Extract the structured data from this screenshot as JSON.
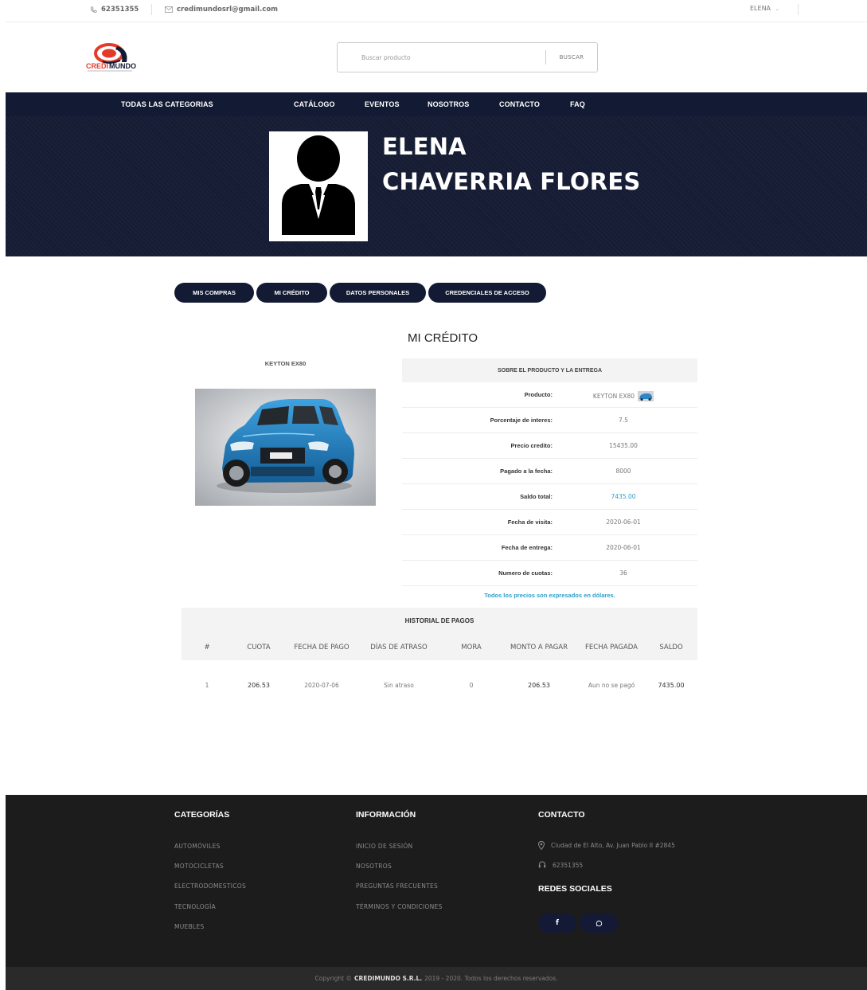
{
  "topbar": {
    "phone": "62351355",
    "email": "credimundosrl@gmail.com",
    "user": "ELENA"
  },
  "brand": {
    "logo_text_a": "CREDI",
    "logo_text_b": "MUNDO",
    "color_red": "#e53a2a",
    "color_navy": "#131a33"
  },
  "search": {
    "placeholder": "Buscar producto",
    "button": "BUSCAR"
  },
  "nav": {
    "categories": "TODAS LAS CATEGORIAS",
    "items": [
      "CATÁLOGO",
      "EVENTOS",
      "NOSOTROS",
      "CONTACTO",
      "FAQ"
    ]
  },
  "profile": {
    "first_name": "ELENA",
    "last_name": "CHAVERRIA FLORES"
  },
  "tabs": [
    "MIS COMPRAS",
    "MI CRÉDITO",
    "DATOS PERSONALES",
    "CREDENCIALES DE ACCESO"
  ],
  "credit": {
    "title": "MI CRÉDITO",
    "product_name": "KEYTON EX80",
    "table_header": "SOBRE EL PRODUCTO Y LA ENTREGA",
    "rows": [
      {
        "label": "Producto:",
        "value": "KEYTON EX80"
      },
      {
        "label": "Porcentaje de interes:",
        "value": "7.5"
      },
      {
        "label": "Precio credito:",
        "value": "15435.00"
      },
      {
        "label": "Pagado a la fecha:",
        "value": "8000"
      },
      {
        "label": "Saldo total:",
        "value": "7435.00"
      },
      {
        "label": "Fecha de visita:",
        "value": "2020-06-01"
      },
      {
        "label": "Fecha de entrega:",
        "value": "2020-06-01"
      },
      {
        "label": "Numero de cuotas:",
        "value": "36"
      }
    ],
    "note": "Todos los precios son expresados en dólares.",
    "accent_color": "#2aa0c8"
  },
  "payments": {
    "title": "HISTORIAL DE PAGOS",
    "columns": [
      "#",
      "CUOTA",
      "FECHA DE PAGO",
      "DÍAS DE ATRASO",
      "MORA",
      "MONTO A PAGAR",
      "FECHA PAGADA",
      "SALDO"
    ],
    "rows": [
      [
        "1",
        "206.53",
        "2020-07-06",
        "Sin atraso",
        "0",
        "206.53",
        "Aun no se pagó",
        "7435.00"
      ]
    ]
  },
  "footer": {
    "categories_title": "CATEGORÍAS",
    "categories": [
      "AUTOMÓVILES",
      "MOTOCICLETAS",
      "ELECTRODOMESTICOS",
      "TECNOLOGÍA",
      "MUEBLES"
    ],
    "info_title": "INFORMACIÓN",
    "info": [
      "INICIO DE SESIÓN",
      "NOSOTROS",
      "PREGUNTAS FRECUENTES",
      "TÉRMINOS Y CONDICIONES"
    ],
    "contact_title": "CONTACTO",
    "address": "Ciudad de El Alto, Av. Juan Pablo II #2845",
    "phone": "62351355",
    "social_title": "REDES SOCIALES",
    "social_icons": [
      "facebook-icon",
      "whatsapp-icon"
    ]
  },
  "copyright": {
    "prefix": "Copyright ©",
    "company": "CREDIMUNDO S.R.L.",
    "suffix": "2019 - 2020. Todos los derechos reservados."
  }
}
